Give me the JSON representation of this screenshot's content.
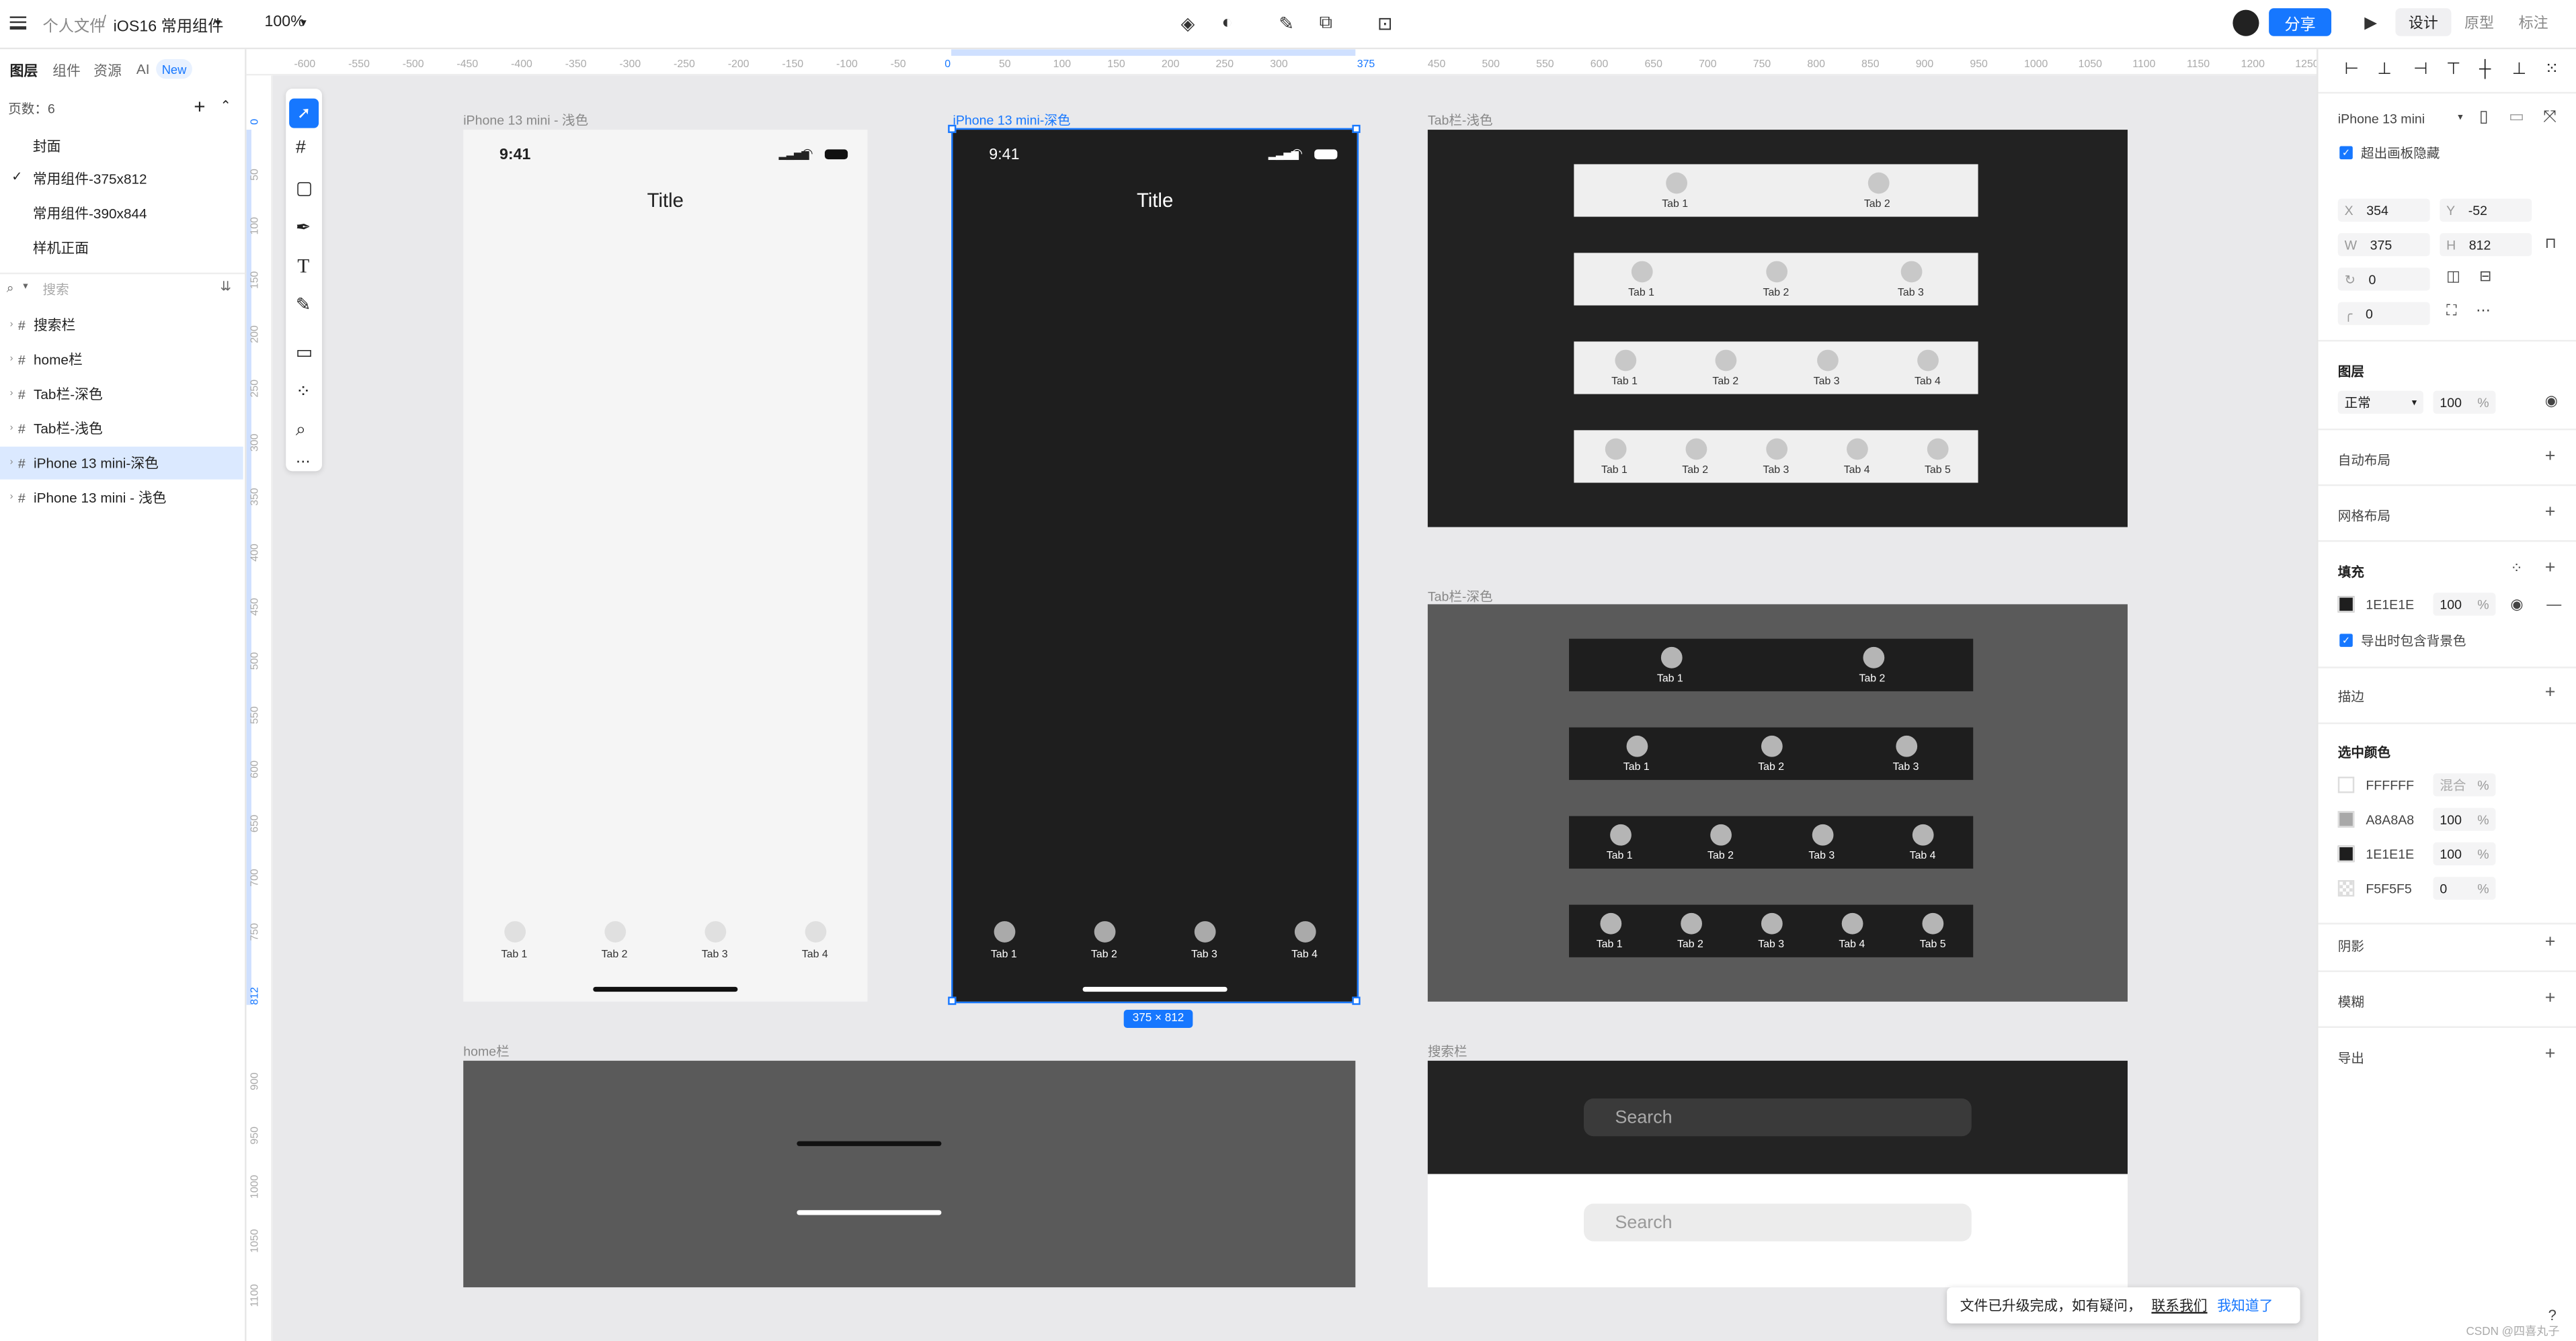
{
  "topbar": {
    "breadcrumb_root": "个人文件",
    "breadcrumb_sep": "/",
    "file_name": "iOS16 常用组件",
    "zoom": "100%",
    "share": "分享",
    "modes": [
      "设计",
      "原型",
      "标注"
    ]
  },
  "left": {
    "tabs": [
      "图层",
      "组件",
      "资源",
      "AI"
    ],
    "new_badge": "New",
    "page_count": "页数：6",
    "pages": [
      "封面",
      "常用组件-375x812",
      "常用组件-390x844",
      "样机正面"
    ],
    "search_placeholder": "搜索",
    "layers": [
      "搜索栏",
      "home栏",
      "Tab栏-深色",
      "Tab栏-浅色",
      "iPhone 13 mini-深色",
      "iPhone 13 mini - 浅色"
    ]
  },
  "hruler_ticks": [
    "-600",
    "-550",
    "-500",
    "-450",
    "-400",
    "-350",
    "-300",
    "-250",
    "-200",
    "-150",
    "-100",
    "-50",
    "0",
    "50",
    "100",
    "150",
    "200",
    "250",
    "300",
    "375",
    "450",
    "500",
    "550",
    "600",
    "650",
    "700",
    "750",
    "800",
    "850",
    "900",
    "950",
    "1000",
    "1050",
    "1100",
    "1150",
    "1200",
    "1250"
  ],
  "vruler_ticks": [
    "0",
    "50",
    "100",
    "150",
    "200",
    "250",
    "300",
    "350",
    "400",
    "450",
    "500",
    "550",
    "600",
    "650",
    "700",
    "750",
    "812",
    "900",
    "950",
    "1000",
    "1050",
    "1100"
  ],
  "canvas": {
    "light_phone": {
      "label": "iPhone 13 mini - 浅色",
      "time": "9:41",
      "title": "Title",
      "tabs": [
        "Tab 1",
        "Tab 2",
        "Tab 3",
        "Tab 4"
      ]
    },
    "dark_phone": {
      "label": "iPhone 13 mini-深色",
      "time": "9:41",
      "title": "Title",
      "tabs": [
        "Tab 1",
        "Tab 2",
        "Tab 3",
        "Tab 4"
      ],
      "size_badge": "375 × 812"
    },
    "tab_light": {
      "label": "Tab栏-浅色",
      "rows": [
        [
          "Tab 1",
          "Tab 2"
        ],
        [
          "Tab 1",
          "Tab 2",
          "Tab 3"
        ],
        [
          "Tab 1",
          "Tab 2",
          "Tab 3",
          "Tab 4"
        ],
        [
          "Tab 1",
          "Tab 2",
          "Tab 3",
          "Tab 4",
          "Tab 5"
        ]
      ]
    },
    "tab_dark": {
      "label": "Tab栏-深色",
      "rows": [
        [
          "Tab 1",
          "Tab 2"
        ],
        [
          "Tab 1",
          "Tab 2",
          "Tab 3"
        ],
        [
          "Tab 1",
          "Tab 2",
          "Tab 3",
          "Tab 4"
        ],
        [
          "Tab 1",
          "Tab 2",
          "Tab 3",
          "Tab 4",
          "Tab 5"
        ]
      ]
    },
    "home_bar": {
      "label": "home栏"
    },
    "search_bar": {
      "label": "搜索栏",
      "placeholder_dark": "Search",
      "placeholder_light": "Search"
    }
  },
  "right": {
    "device": "iPhone 13 mini",
    "clip_content": "超出画板隐藏",
    "x": "354",
    "y": "-52",
    "w": "375",
    "h": "812",
    "rotation": "0",
    "radius": "0",
    "x_label": "X",
    "y_label": "Y",
    "w_label": "W",
    "h_label": "H",
    "layer_section": "图层",
    "blend_mode": "正常",
    "opacity": "100",
    "percent": "%",
    "auto_layout": "自动布局",
    "grid_layout": "网格布局",
    "fill_section": "填充",
    "fill_hex": "1E1E1E",
    "fill_opacity": "100",
    "export_bg": "导出时包含背景色",
    "stroke_section": "描边",
    "selected_colors": "选中颜色",
    "colors": [
      {
        "hex": "FFFFFF",
        "opacity": "混合"
      },
      {
        "hex": "A8A8A8",
        "opacity": "100"
      },
      {
        "hex": "1E1E1E",
        "opacity": "100"
      },
      {
        "hex": "F5F5F5",
        "opacity": "0"
      }
    ],
    "shadow": "阴影",
    "blur": "模糊",
    "export": "导出"
  },
  "toast": {
    "message": "文件已升级完成，如有疑问，",
    "contact": "联系我们",
    "ok": "我知道了"
  },
  "watermark": "CSDN @四喜丸子",
  "colors": {
    "accent": "#1677ff",
    "dark_frame": "#1e1e1e",
    "mid_gray": "#5a5a5a",
    "light_frame": "#f5f5f5"
  }
}
